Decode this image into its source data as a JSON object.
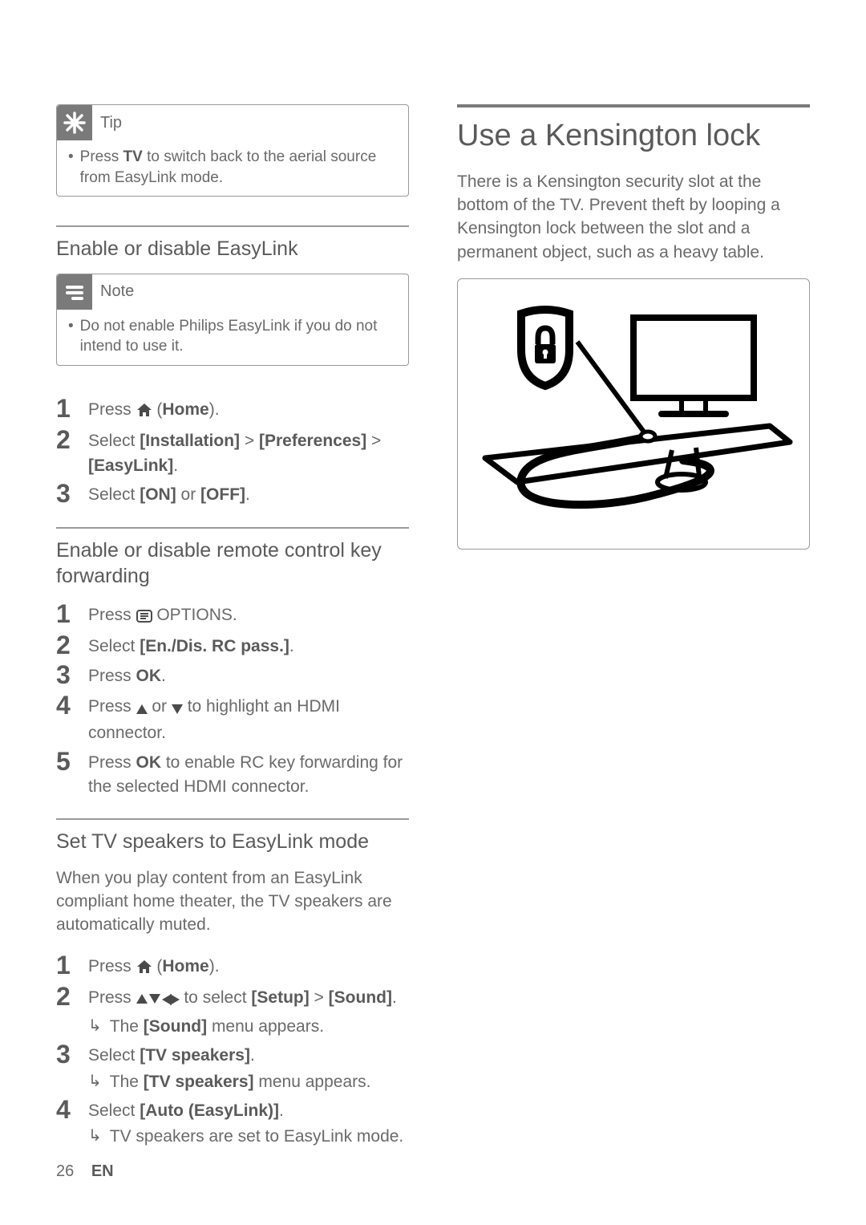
{
  "left": {
    "tip": {
      "label": "Tip",
      "text_before": "Press ",
      "text_bold": "TV",
      "text_after": " to switch back to the aerial source from EasyLink mode."
    },
    "easylink_toggle": {
      "heading": "Enable or disable EasyLink",
      "note_label": "Note",
      "note_text": "Do not enable Philips EasyLink if you do not intend to use it.",
      "step1_a": "Press ",
      "step1_b": " (",
      "step1_c": "Home",
      "step1_d": ").",
      "step2_a": "Select ",
      "step2_b": "[Installation]",
      "step2_c": " > ",
      "step2_d": "[Preferences]",
      "step2_e": " > ",
      "step2_f": "[EasyLink]",
      "step2_g": ".",
      "step3_a": "Select ",
      "step3_b": "[ON]",
      "step3_c": " or ",
      "step3_d": "[OFF]",
      "step3_e": "."
    },
    "rc_forward": {
      "heading": "Enable or disable remote control key forwarding",
      "step1_a": "Press ",
      "step1_b": " OPTIONS.",
      "step2_a": "Select ",
      "step2_b": "[En./Dis. RC pass.]",
      "step2_c": ".",
      "step3_a": "Press ",
      "step3_b": "OK",
      "step3_c": ".",
      "step4_a": "Press ",
      "step4_b": " or ",
      "step4_c": " to highlight an HDMI connector.",
      "step5_a": "Press ",
      "step5_b": "OK",
      "step5_c": " to enable RC key forwarding for the selected HDMI connector."
    },
    "speakers": {
      "heading": "Set TV speakers to EasyLink mode",
      "intro": "When you play content from an EasyLink compliant home theater, the TV speakers are automatically muted.",
      "step1_a": "Press ",
      "step1_b": " (",
      "step1_c": "Home",
      "step1_d": ").",
      "step2_a": "Press ",
      "step2_b": " to select ",
      "step2_c": "[Setup]",
      "step2_d": " > ",
      "step2_e": "[Sound]",
      "step2_f": ".",
      "step2_sub_a": "The ",
      "step2_sub_b": "[Sound]",
      "step2_sub_c": " menu appears.",
      "step3_a": "Select ",
      "step3_b": "[TV speakers]",
      "step3_c": ".",
      "step3_sub_a": "The ",
      "step3_sub_b": "[TV speakers]",
      "step3_sub_c": " menu appears.",
      "step4_a": "Select ",
      "step4_b": "[Auto (EasyLink)]",
      "step4_c": ".",
      "step4_sub": "TV speakers are set to EasyLink mode."
    }
  },
  "right": {
    "heading": "Use a Kensington lock",
    "para": "There is a Kensington security slot at the bottom of the TV. Prevent theft by looping a Kensington lock between the slot and a permanent object, such as a heavy table."
  },
  "footer": {
    "page": "26",
    "lang": "EN"
  },
  "icons": {
    "home": "home-icon",
    "options": "options-icon",
    "up": "up-triangle-icon",
    "down": "down-triangle-icon",
    "left": "left-triangle-icon",
    "right": "right-triangle-icon",
    "result_arrow": "result-arrow-icon",
    "tip": "tip-asterisk-icon",
    "note": "note-lines-icon",
    "kensington": "kensington-lock-illustration"
  }
}
